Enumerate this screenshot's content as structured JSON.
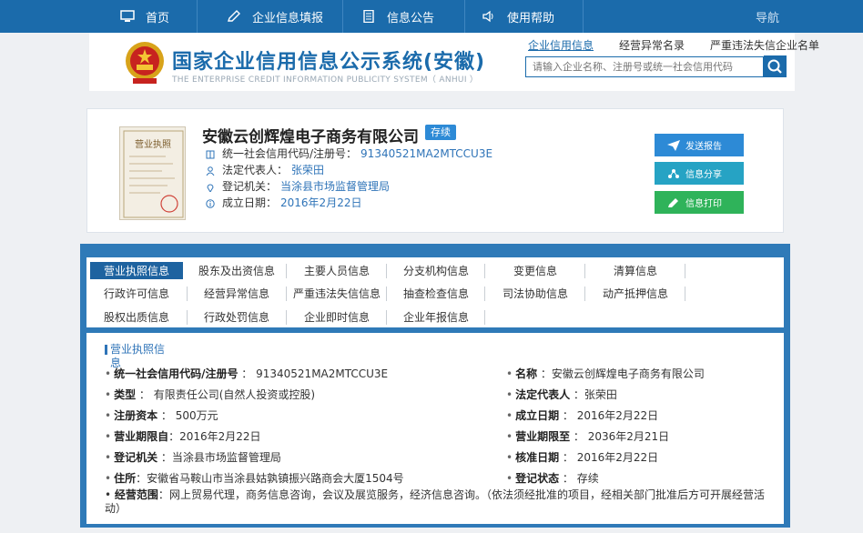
{
  "nav": {
    "items": [
      {
        "label": "首页",
        "icon": "monitor-icon"
      },
      {
        "label": "企业信息填报",
        "icon": "edit-icon"
      },
      {
        "label": "信息公告",
        "icon": "document-icon"
      },
      {
        "label": "使用帮助",
        "icon": "speaker-icon"
      }
    ],
    "right": "导航"
  },
  "header": {
    "title": "国家企业信用信息公示系统(安徽)",
    "subtitle": "THE ENTERPRISE CREDIT INFORMATION PUBLICITY SYSTEM（ ANHUI ）",
    "links": [
      "企业信用信息",
      "经营异常名录",
      "严重违法失信企业名单"
    ],
    "search_placeholder": "请输入企业名称、注册号或统一社会信用代码"
  },
  "company": {
    "name": "安徽云创辉煌电子商务有限公司",
    "status": "存续",
    "credit_code_label": "统一社会信用代码/注册号：",
    "credit_code": "91340521MA2MTCCU3E",
    "legal_rep_label": "法定代表人：",
    "legal_rep": "张荣田",
    "reg_authority_label": "登记机关：",
    "reg_authority": "当涂县市场监督管理局",
    "established_label": "成立日期：",
    "established": "2016年2月22日",
    "license_thumb_text": "营业执照",
    "actions": [
      "发送报告",
      "信息分享",
      "信息打印"
    ]
  },
  "tabs": [
    [
      "营业执照信息",
      "股东及出资信息",
      "主要人员信息",
      "分支机构信息",
      "变更信息",
      "清算信息"
    ],
    [
      "行政许可信息",
      "经营异常信息",
      "严重违法失信信息",
      "抽查检查信息",
      "司法协助信息",
      "动产抵押信息"
    ],
    [
      "股权出质信息",
      "行政处罚信息",
      "企业即时信息",
      "企业年报信息"
    ]
  ],
  "license": {
    "section_title": "营业执照信息",
    "left": [
      {
        "k": "统一社会信用代码/注册号",
        "v": "91340521MA2MTCCU3E"
      },
      {
        "k": "类型",
        "v": "有限责任公司(自然人投资或控股)"
      },
      {
        "k": "注册资本",
        "v": "500万元"
      },
      {
        "k": "营业期限自",
        "v": "2016年2月22日"
      },
      {
        "k": "登记机关",
        "v": "当涂县市场监督管理局"
      },
      {
        "k": "住所",
        "v": "安徽省马鞍山市当涂县姑孰镇振兴路商会大厦1504号"
      }
    ],
    "right": [
      {
        "k": "名称",
        "v": "安徽云创辉煌电子商务有限公司"
      },
      {
        "k": "法定代表人",
        "v": "张荣田"
      },
      {
        "k": "成立日期",
        "v": "2016年2月22日"
      },
      {
        "k": "营业期限至",
        "v": "2036年2月21日"
      },
      {
        "k": "核准日期",
        "v": "2016年2月22日"
      },
      {
        "k": "登记状态",
        "v": "存续"
      }
    ],
    "scope_label": "经营范围",
    "scope": "网上贸易代理，商务信息咨询，会议及展览服务，经济信息咨询。（依法须经批准的项目，经相关部门批准后方可开展经营活动）"
  },
  "colors": {
    "nav_bg": "#1b6bab",
    "accent": "#2d8ad6",
    "btn_share": "#26a3c4",
    "btn_print": "#2fb35a"
  }
}
